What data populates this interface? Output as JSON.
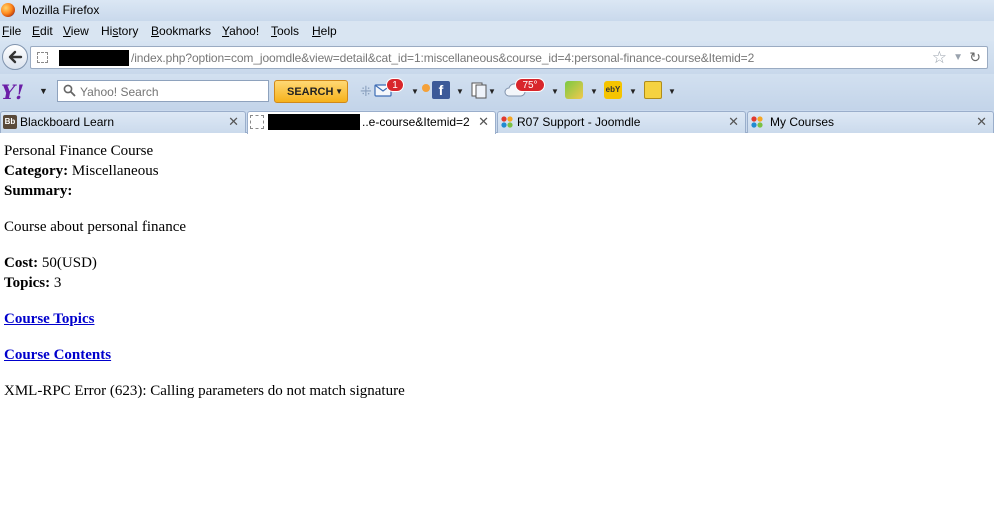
{
  "window": {
    "title": "Mozilla Firefox"
  },
  "menu": {
    "items": [
      {
        "first": "F",
        "rest": "ile"
      },
      {
        "first": "E",
        "rest": "dit"
      },
      {
        "first": "V",
        "rest": "iew"
      },
      {
        "pre": "Hi",
        "first": "s",
        "rest": "tory"
      },
      {
        "first": "B",
        "rest": "ookmarks"
      },
      {
        "first": "Y",
        "rest": "ahoo!"
      },
      {
        "first": "T",
        "rest": "ools"
      },
      {
        "first": "H",
        "rest": "elp"
      }
    ]
  },
  "nav": {
    "url": "/index.php?option=com_joomdle&view=detail&cat_id=1:miscellaneous&course_id=4:personal-finance-course&Itemid=2"
  },
  "yahoo": {
    "logo": "Y!",
    "search_placeholder": "Yahoo! Search",
    "search_button": "SEARCH",
    "mail_count": "1",
    "weather_temp": "75°",
    "ebay_label": "ebY",
    "facebook_label": "f",
    "blackboard_label": "Bb"
  },
  "tabs": [
    {
      "label": "Blackboard Learn",
      "icon": "blackboard-icon"
    },
    {
      "label": "..e-course&Itemid=2",
      "icon": "page-icon",
      "active": true
    },
    {
      "label": "R07 Support - Joomdle",
      "icon": "joomla-icon"
    },
    {
      "label": "My Courses",
      "icon": "joomla-icon"
    }
  ],
  "content": {
    "course_title": "Personal Finance Course",
    "category_label": "Category:",
    "category_value": "Miscellaneous",
    "summary_label": "Summary:",
    "summary_text": "Course about personal finance",
    "cost_label": "Cost:",
    "cost_value": "50(USD)",
    "topics_label": "Topics:",
    "topics_value": "3",
    "link_topics": "Course Topics",
    "link_contents": "Course Contents",
    "error": "XML-RPC Error (623): Calling parameters do not match signature"
  }
}
